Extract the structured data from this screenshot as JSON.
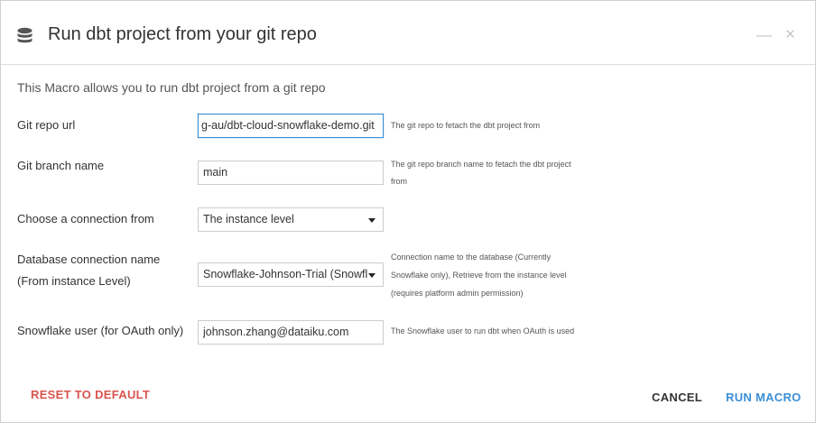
{
  "dialog": {
    "title": "Run dbt project from your git repo",
    "icon": "database-icon",
    "minimize_label": "—",
    "close_label": "×"
  },
  "intro": "This Macro allows you to run dbt project from a git repo",
  "fields": {
    "git_repo_url": {
      "label": "Git repo url",
      "value": "g-au/dbt-cloud-snowflake-demo.git",
      "help": "The git repo to fetach the dbt project from"
    },
    "git_branch": {
      "label": "Git branch name",
      "value": "main",
      "help_line1": "The git repo branch name to fetach the dbt project",
      "help_line2": "from"
    },
    "connection_from": {
      "label": "Choose a connection from",
      "value": "The instance level"
    },
    "db_connection": {
      "label_line1": "Database connection name",
      "label_line2": "(From instance Level)",
      "value": "Snowflake-Johnson-Trial (Snowfl",
      "help_line1": "Connection name to the database (Currently",
      "help_line2": "Snowflake only), Retrieve from the instance level",
      "help_line3": "(requires platform admin permission)"
    },
    "snowflake_user": {
      "label": "Snowflake user (for OAuth only)",
      "value": "johnson.zhang@dataiku.com",
      "help": "The Snowflake user to run dbt when OAuth is used"
    }
  },
  "footer": {
    "reset_label": "RESET TO DEFAULT",
    "cancel_label": "CANCEL",
    "run_label": "RUN MACRO"
  },
  "colors": {
    "reset": "#d9534f",
    "run": "#3b8fd6",
    "cancel": "#333333"
  }
}
